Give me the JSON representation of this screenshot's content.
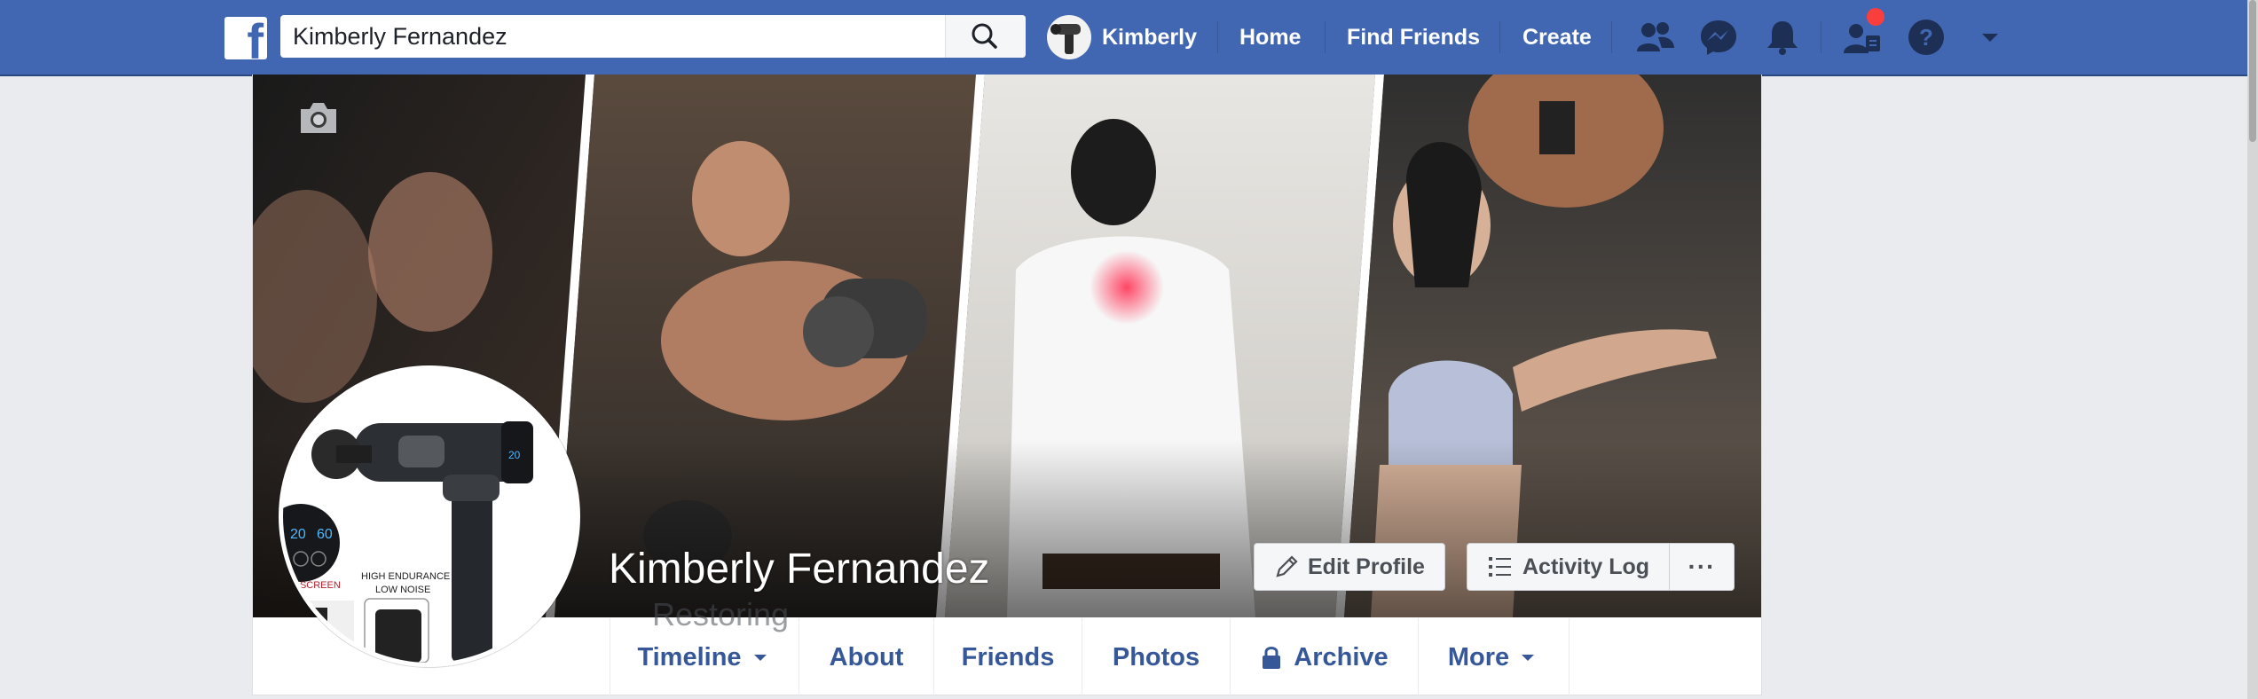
{
  "header": {
    "search": {
      "value": "Kimberly Fernandez"
    },
    "profile_link": {
      "label": "Kimberly"
    },
    "nav": [
      {
        "label": "Home"
      },
      {
        "label": "Find Friends"
      },
      {
        "label": "Create"
      }
    ],
    "icons": [
      "friend-requests-icon",
      "messenger-icon",
      "notifications-icon",
      "quick-help-people-icon",
      "help-icon",
      "account-menu-caret-icon"
    ]
  },
  "cover": {
    "profile_name": "Kimberly Fernandez",
    "partial_text_below_name": "Restoring",
    "buttons": {
      "edit_profile": "Edit Profile",
      "activity_log": "Activity Log",
      "more": "···"
    },
    "product_labels": {
      "line1": "HIGH ENDURANCE",
      "line2": "LOW NOISE",
      "screen": "CH SCREEN",
      "display_a": "20",
      "display_b": "60"
    }
  },
  "tabs": [
    {
      "label": "Timeline"
    },
    {
      "label": "About"
    },
    {
      "label": "Friends"
    },
    {
      "label": "Photos"
    },
    {
      "label": "Archive"
    },
    {
      "label": "More"
    }
  ],
  "colors": {
    "brand": "#4267b2",
    "link": "#365899",
    "notification": "#fa3e3e",
    "page_bg": "#e9ebee"
  }
}
